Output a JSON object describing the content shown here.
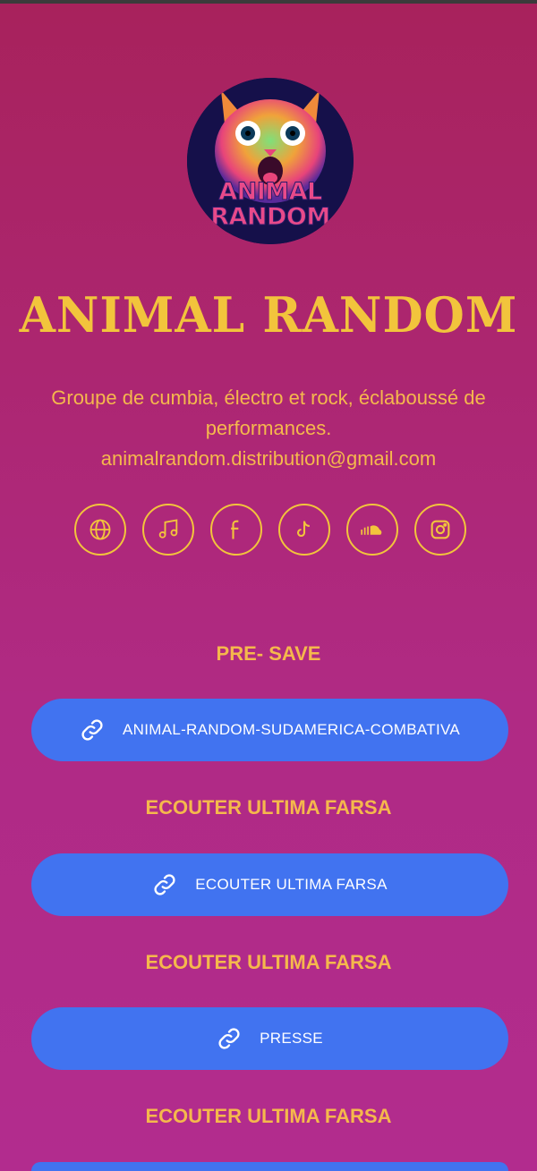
{
  "profile": {
    "name": "ANIMAL RANDOM",
    "logo_text_line1": "ANIMAL",
    "logo_text_line2": "RANDOM",
    "bio_line1": "Groupe de cumbia, électro et rock, éclaboussé de",
    "bio_line2": "performances.",
    "email": "animalrandom.distribution@gmail.com"
  },
  "socials": [
    {
      "icon": "globe-icon"
    },
    {
      "icon": "music-note-icon"
    },
    {
      "icon": "facebook-icon"
    },
    {
      "icon": "tiktok-icon"
    },
    {
      "icon": "soundcloud-icon"
    },
    {
      "icon": "instagram-icon"
    }
  ],
  "sections": [
    {
      "label": "PRE- SAVE",
      "button": "ANIMAL-RANDOM-SUDAMERICA-COMBATIVA"
    },
    {
      "label": "ECOUTER ULTIMA FARSA",
      "button": "ECOUTER ULTIMA FARSA"
    },
    {
      "label": "ECOUTER ULTIMA FARSA",
      "button": "PRESSE"
    },
    {
      "label": "ECOUTER ULTIMA FARSA",
      "button": ""
    }
  ],
  "colors": {
    "accent_yellow": "#f2c43c",
    "button_blue": "#4173f0",
    "background_top": "#a8225c",
    "background_bottom": "#b22c8e"
  }
}
